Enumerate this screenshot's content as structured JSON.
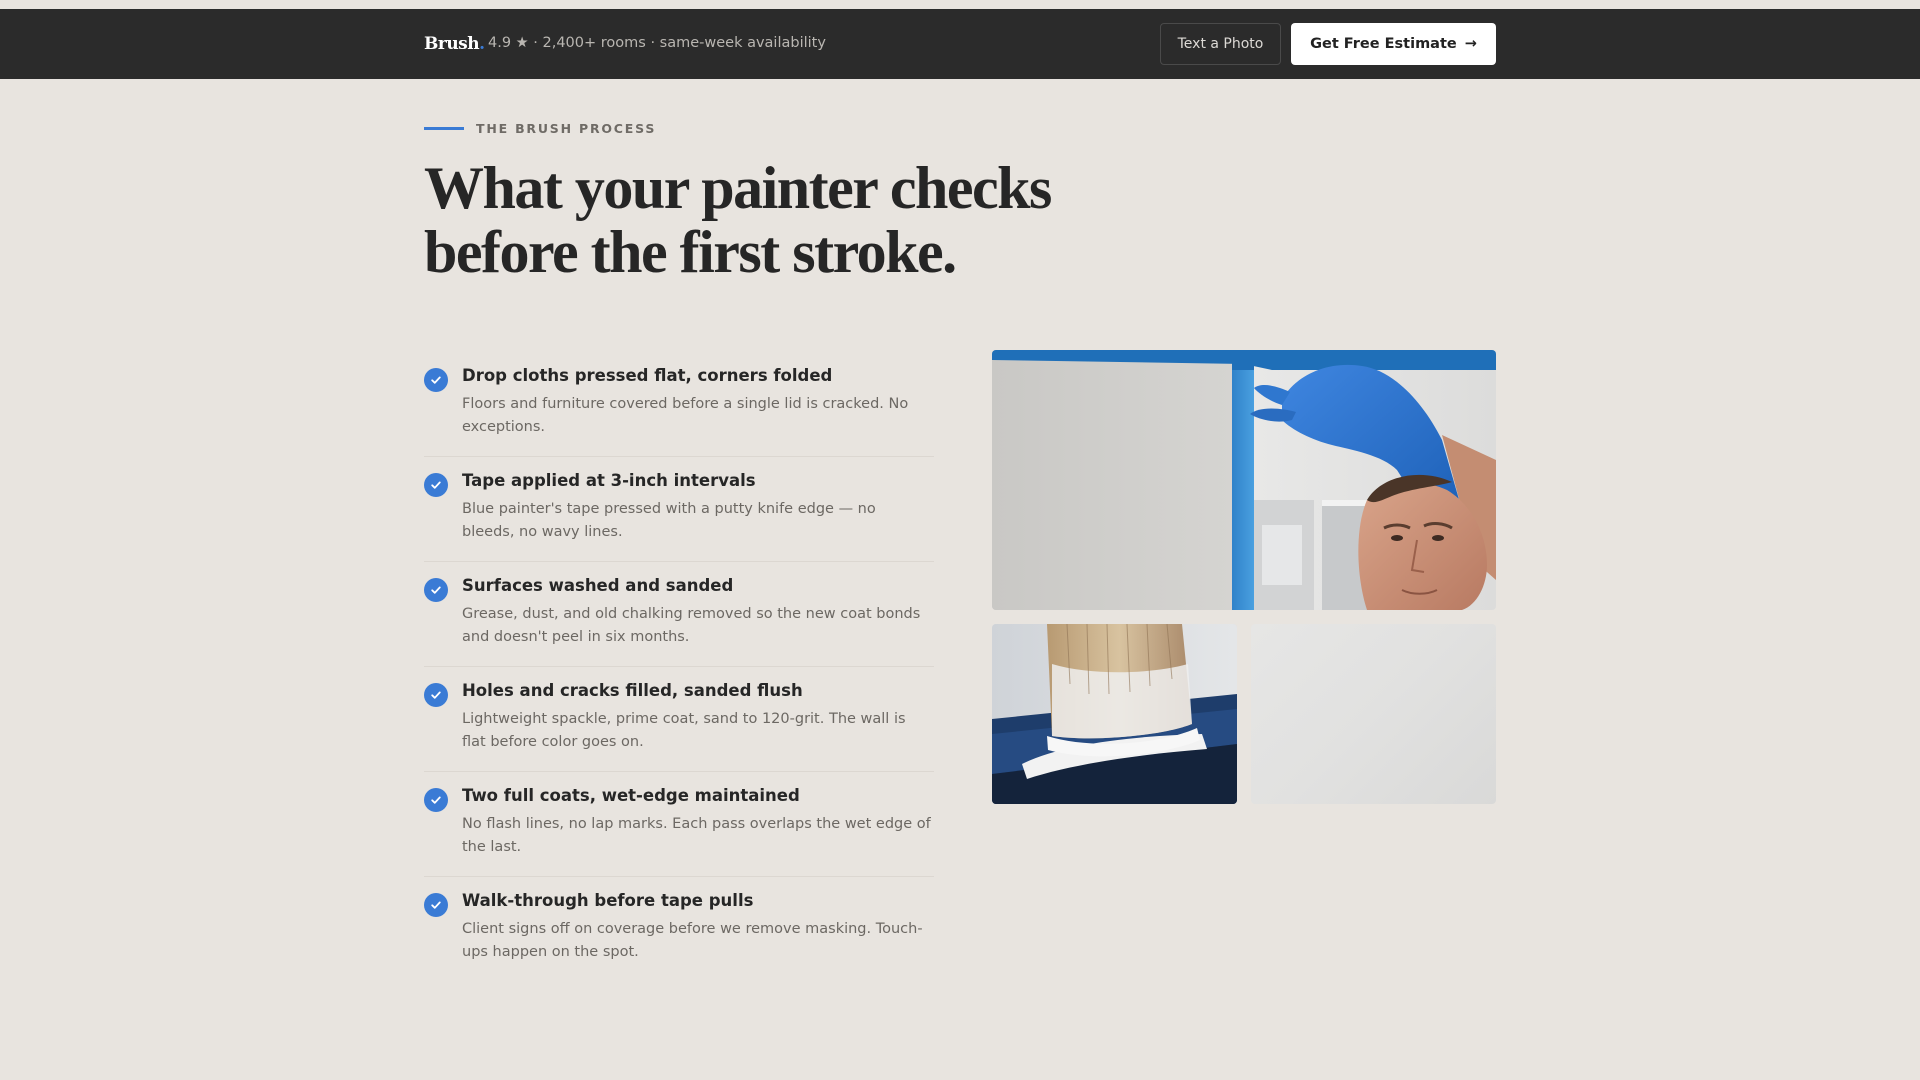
{
  "header": {
    "brand": "Brush",
    "brand_dot": ".",
    "tagline": "4.9 ★ · 2,400+ rooms · same-week availability",
    "text_photo_label": "Text a Photo",
    "estimate_label": "Get Free Estimate",
    "estimate_arrow": "→"
  },
  "hero": {
    "eyebrow": "THE BRUSH PROCESS",
    "headline_line1": "What your painter checks",
    "headline_line2": "before the first stroke."
  },
  "checklist": [
    {
      "title": "Drop cloths pressed flat, corners folded",
      "desc": "Floors and furniture covered before a single lid is cracked. No exceptions."
    },
    {
      "title": "Tape applied at 3-inch intervals",
      "desc": "Blue painter's tape pressed with a putty knife edge — no bleeds, no wavy lines."
    },
    {
      "title": "Surfaces washed and sanded",
      "desc": "Grease, dust, and old chalking removed so the new coat bonds and doesn't peel in six months."
    },
    {
      "title": "Holes and cracks filled, sanded flush",
      "desc": "Lightweight spackle, prime coat, sand to 120-grit. The wall is flat before color goes on."
    },
    {
      "title": "Two full coats, wet-edge maintained",
      "desc": "No flash lines, no lap marks. Each pass overlaps the wet edge of the last."
    },
    {
      "title": "Walk-through before tape pulls",
      "desc": "Client signs off on coverage before we remove masking. Touch-ups happen on the spot."
    }
  ],
  "colors": {
    "accent": "#3a7bd5",
    "navbar": "#2b2b2b",
    "background": "#e8e4df"
  }
}
